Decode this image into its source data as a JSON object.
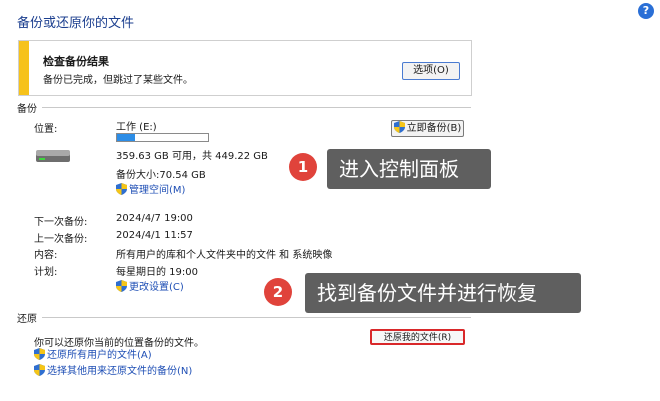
{
  "window": {
    "title": "备份或还原你的文件",
    "help_icon": "?"
  },
  "alert": {
    "heading": "检查备份结果",
    "text": "备份已完成，但跳过了某些文件。",
    "options_button": "选项(O)",
    "bar_color": "#f6c21b"
  },
  "backup": {
    "section_label": "备份",
    "location_label": "位置:",
    "drive_name": "工作 (E:)",
    "used_fraction": 0.2,
    "space_text": "359.63 GB 可用，共 449.22 GB",
    "size_text": "备份大小:70.54 GB",
    "manage_space_link": "管理空间(M)",
    "backup_now_button": "立即备份(B)",
    "rows": [
      {
        "label": "下一次备份:",
        "value": "2024/4/7 19:00"
      },
      {
        "label": "上一次备份:",
        "value": "2024/4/1 11:57"
      },
      {
        "label": "内容:",
        "value": "所有用户的库和个人文件夹中的文件 和 系统映像"
      },
      {
        "label": "计划:",
        "value": "每星期日的 19:00"
      }
    ],
    "change_settings_link": "更改设置(C)"
  },
  "restore": {
    "section_label": "还原",
    "desc": "你可以还原你当前的位置备份的文件。",
    "restore_button": "还原我的文件(R)",
    "all_users_link": "还原所有用户的文件(A)",
    "other_backup_link": "选择其他用来还原文件的备份(N)"
  },
  "annotations": [
    {
      "number": "1",
      "text": "进入控制面板"
    },
    {
      "number": "2",
      "text": "找到备份文件并进行恢复"
    }
  ],
  "colors": {
    "accent": "#2d8de6",
    "highlight": "#d9282a",
    "badge": "#e0433b",
    "link": "#1f4fb5"
  }
}
